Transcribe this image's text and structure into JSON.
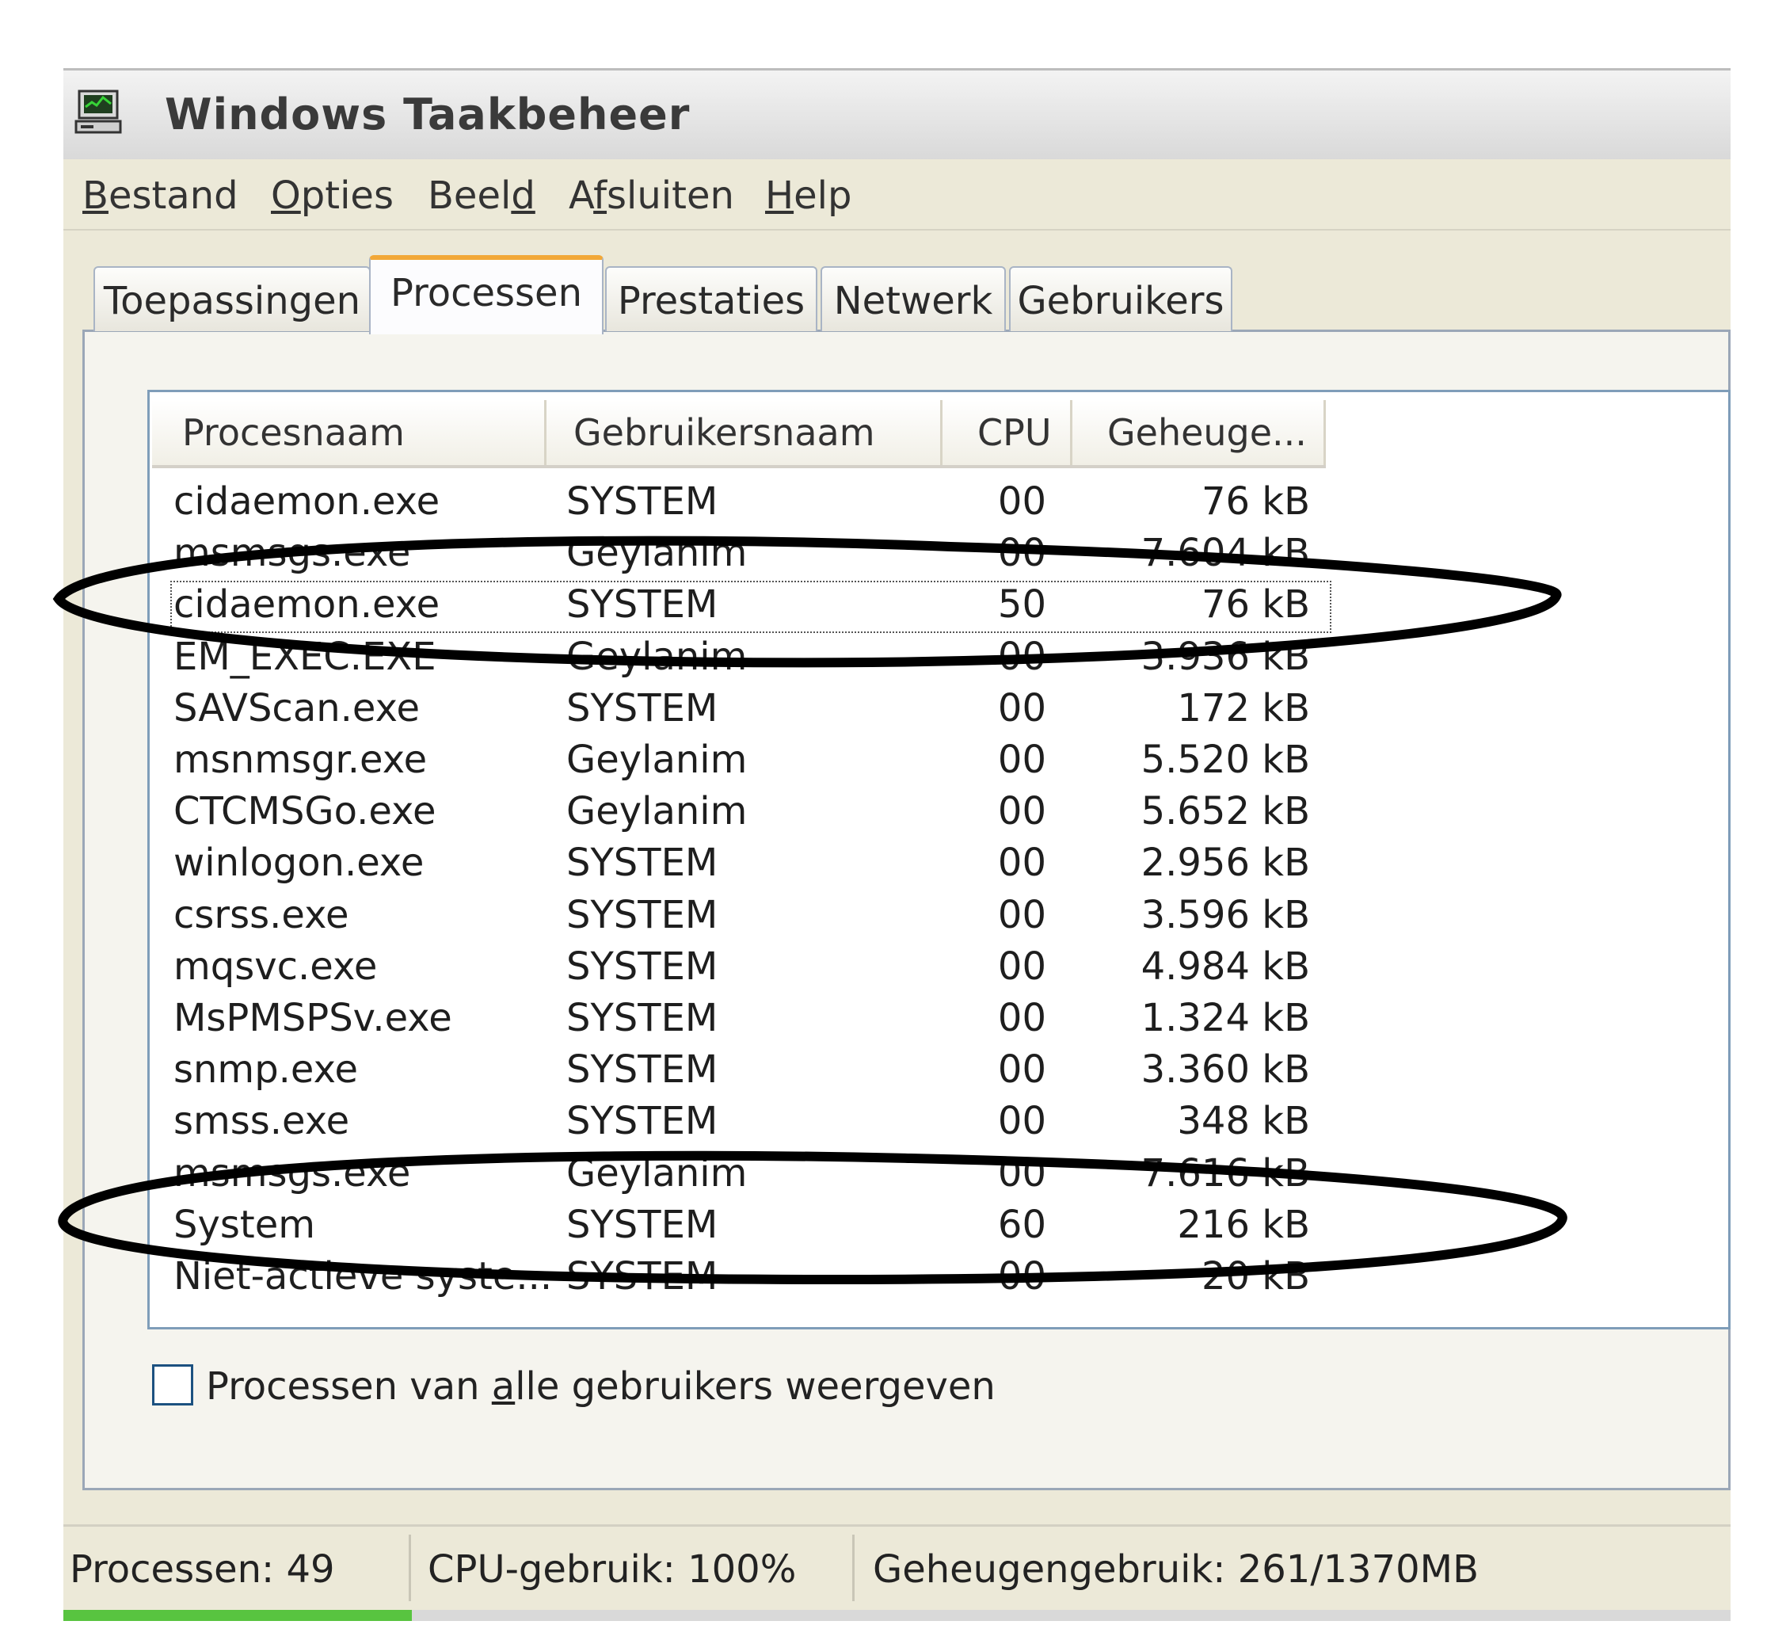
{
  "window": {
    "title": "Windows Taakbeheer",
    "icon": "computer-icon"
  },
  "menu": [
    {
      "before": "",
      "underline": "B",
      "after": "estand"
    },
    {
      "before": "",
      "underline": "O",
      "after": "pties"
    },
    {
      "before": "Beel",
      "underline": "d",
      "after": ""
    },
    {
      "before": "A",
      "underline": "f",
      "after": "sluiten"
    },
    {
      "before": "",
      "underline": "H",
      "after": "elp"
    }
  ],
  "tabs": [
    {
      "label": "Toepassingen",
      "active": false
    },
    {
      "label": "Processen",
      "active": true
    },
    {
      "label": "Prestaties",
      "active": false
    },
    {
      "label": "Netwerk",
      "active": false
    },
    {
      "label": "Gebruikers",
      "active": false
    }
  ],
  "table": {
    "headers": [
      "Procesnaam",
      "Gebruikersnaam",
      "CPU",
      "Geheuge..."
    ],
    "rows": [
      {
        "name": "cidaemon.exe",
        "user": "SYSTEM",
        "cpu": "00",
        "mem": "76 kB"
      },
      {
        "name": "msmsgs.exe",
        "user": "Geylanim",
        "cpu": "00",
        "mem": "7.604 kB"
      },
      {
        "name": "cidaemon.exe",
        "user": "SYSTEM",
        "cpu": "50",
        "mem": "76 kB"
      },
      {
        "name": "EM_EXEC.EXE",
        "user": "Geylanim",
        "cpu": "00",
        "mem": "3.936 kB"
      },
      {
        "name": "SAVScan.exe",
        "user": "SYSTEM",
        "cpu": "00",
        "mem": "172 kB"
      },
      {
        "name": "msnmsgr.exe",
        "user": "Geylanim",
        "cpu": "00",
        "mem": "5.520 kB"
      },
      {
        "name": "CTCMSGo.exe",
        "user": "Geylanim",
        "cpu": "00",
        "mem": "5.652 kB"
      },
      {
        "name": "winlogon.exe",
        "user": "SYSTEM",
        "cpu": "00",
        "mem": "2.956 kB"
      },
      {
        "name": "csrss.exe",
        "user": "SYSTEM",
        "cpu": "00",
        "mem": "3.596 kB"
      },
      {
        "name": "mqsvc.exe",
        "user": "SYSTEM",
        "cpu": "00",
        "mem": "4.984 kB"
      },
      {
        "name": "MsPMSPSv.exe",
        "user": "SYSTEM",
        "cpu": "00",
        "mem": "1.324 kB"
      },
      {
        "name": "snmp.exe",
        "user": "SYSTEM",
        "cpu": "00",
        "mem": "3.360 kB"
      },
      {
        "name": "smss.exe",
        "user": "SYSTEM",
        "cpu": "00",
        "mem": "348 kB"
      },
      {
        "name": "msmsgs.exe",
        "user": "Geylanim",
        "cpu": "00",
        "mem": "7.616 kB"
      },
      {
        "name": "System",
        "user": "SYSTEM",
        "cpu": "60",
        "mem": "216 kB"
      },
      {
        "name": "Niet-actieve syste...",
        "user": "SYSTEM",
        "cpu": "00",
        "mem": "20 kB"
      }
    ]
  },
  "checkbox": {
    "label_before": "Processen van ",
    "label_underline": "a",
    "label_after": "lle gebruikers weergeven",
    "checked": false
  },
  "status": {
    "processes": "Processen: 49",
    "cpu": "CPU-gebruik: 100%",
    "memory": "Geheugengebruik: 261/1370MB"
  },
  "colors": {
    "accent_tab": "#f2a838",
    "annotation_ink": "#000000",
    "progress_green": "#58c440"
  }
}
